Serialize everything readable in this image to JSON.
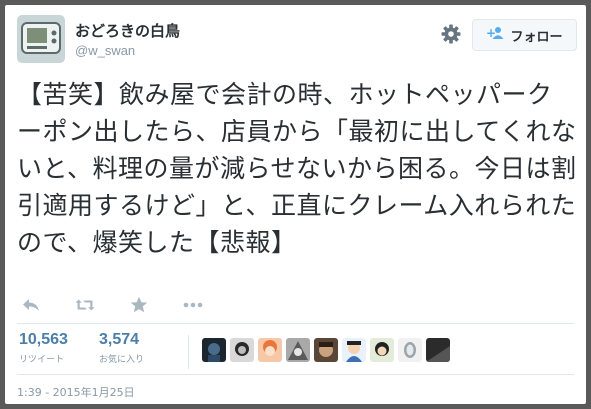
{
  "user": {
    "display_name": "おどろきの白鳥",
    "handle": "@w_swan"
  },
  "header": {
    "settings_icon": "gear-icon",
    "follow_label": "フォロー",
    "follow_icon": "add-user-icon"
  },
  "tweet": {
    "text": "【苦笑】飲み屋で会計の時、ホットペッパークーポン出したら、店員から「最初に出してくれないと、料理の量が減らせないから困る。今日は割引適用するけど」と、正直にクレーム入れられたので、爆笑した【悲報】"
  },
  "actions": [
    {
      "icon": "reply-icon"
    },
    {
      "icon": "retweet-icon"
    },
    {
      "icon": "favorite-star-icon"
    },
    {
      "icon": "more-dots-icon"
    }
  ],
  "stats": {
    "retweets": {
      "count": "10,563",
      "label": "リツイート"
    },
    "favorites": {
      "count": "3,574",
      "label": "お気に入り"
    }
  },
  "timestamp": "1:39 - 2015年1月25日",
  "colors": {
    "link_blue": "#4b7ea8",
    "muted": "#8899a6",
    "text": "#292f33",
    "border": "#e1e8ed"
  }
}
